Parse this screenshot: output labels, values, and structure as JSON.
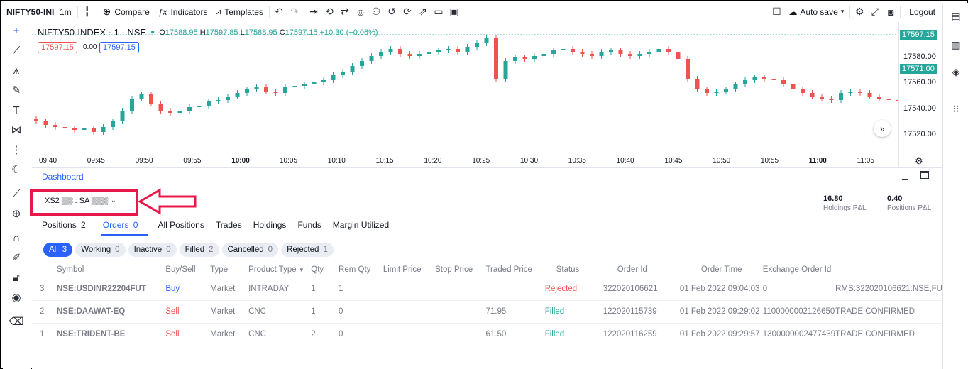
{
  "topbar": {
    "symbol": "NIFTY50-INI",
    "interval": "1m",
    "compare": "Compare",
    "indicators": "Indicators",
    "templates": "Templates",
    "autosave": "Auto save",
    "logout": "Logout"
  },
  "legend": {
    "title": "NIFTY50-INDEX · 1 · NSE",
    "open_label": "O",
    "open": "17588.95",
    "high_label": "H",
    "high": "17597.85",
    "low_label": "L",
    "low": "17588.95",
    "close_label": "C",
    "close": "17597.15",
    "change": "+10.30 (+0.06%)",
    "sell_box": "17597.15",
    "spread": "0.00",
    "buy_box": "17597.15"
  },
  "price_axis": {
    "labels": [
      "17580.00",
      "17560.00",
      "17540.00",
      "17520.00"
    ],
    "badge_last": "17597.15",
    "badge_mid": "17571.00"
  },
  "time_axis": [
    "09:40",
    "09:45",
    "09:50",
    "09:55",
    "10:00",
    "10:05",
    "10:10",
    "10:15",
    "10:20",
    "10:25",
    "10:30",
    "10:35",
    "10:40",
    "10:45",
    "10:50",
    "10:55",
    "11:00",
    "11:05"
  ],
  "dashboard": {
    "title": "Dashboard",
    "account": "XS2 ▒▒ : SA ▒▒▒",
    "holdings_pl_value": "16.80",
    "holdings_pl_label": "Holdings P&L",
    "positions_pl_value": "0.40",
    "positions_pl_label": "Positions P&L"
  },
  "tabs": [
    {
      "label": "Positions",
      "count": "2"
    },
    {
      "label": "Orders",
      "count": "0"
    },
    {
      "label": "All Positions"
    },
    {
      "label": "Trades"
    },
    {
      "label": "Holdings"
    },
    {
      "label": "Funds"
    },
    {
      "label": "Margin Utilized"
    }
  ],
  "filters": [
    {
      "label": "All",
      "count": "3"
    },
    {
      "label": "Working",
      "count": "0"
    },
    {
      "label": "Inactive",
      "count": "0"
    },
    {
      "label": "Filled",
      "count": "2"
    },
    {
      "label": "Cancelled",
      "count": "0"
    },
    {
      "label": "Rejected",
      "count": "1"
    }
  ],
  "columns": [
    "Symbol",
    "Buy/Sell",
    "Type",
    "Product Type",
    "Qty",
    "Rem Qty",
    "Limit Price",
    "Stop Price",
    "Traded Price",
    "Status",
    "Order Id",
    "Order Time",
    "Exchange Order Id"
  ],
  "orders": [
    {
      "n": "3",
      "symbol": "NSE:USDINR22204FUT",
      "side": "Buy",
      "type": "Market",
      "product": "INTRADAY",
      "qty": "1",
      "rem": "1",
      "limit": "",
      "stop": "",
      "traded": "",
      "status": "Rejected",
      "order_id": "322020106621",
      "time": "01 Feb 2022 09:04:03",
      "exch_id": "0",
      "msg": "RMS:322020106621:NSE,FU"
    },
    {
      "n": "2",
      "symbol": "NSE:DAAWAT-EQ",
      "side": "Sell",
      "type": "Market",
      "product": "CNC",
      "qty": "1",
      "rem": "0",
      "limit": "",
      "stop": "",
      "traded": "71.95",
      "status": "Filled",
      "order_id": "122020115739",
      "time": "01 Feb 2022 09:29:02",
      "exch_id": "1100000002126650",
      "msg": "TRADE CONFIRMED"
    },
    {
      "n": "1",
      "symbol": "NSE:TRIDENT-BE",
      "side": "Sell",
      "type": "Market",
      "product": "CNC",
      "qty": "2",
      "rem": "0",
      "limit": "",
      "stop": "",
      "traded": "61.50",
      "status": "Filled",
      "order_id": "122020116259",
      "time": "01 Feb 2022 09:29:57",
      "exch_id": "1300000002477439",
      "msg": "TRADE CONFIRMED"
    }
  ],
  "colors": {
    "up": "#26a69a",
    "down": "#ef5350",
    "accent": "#2962ff",
    "highlight": "#e8194a"
  }
}
